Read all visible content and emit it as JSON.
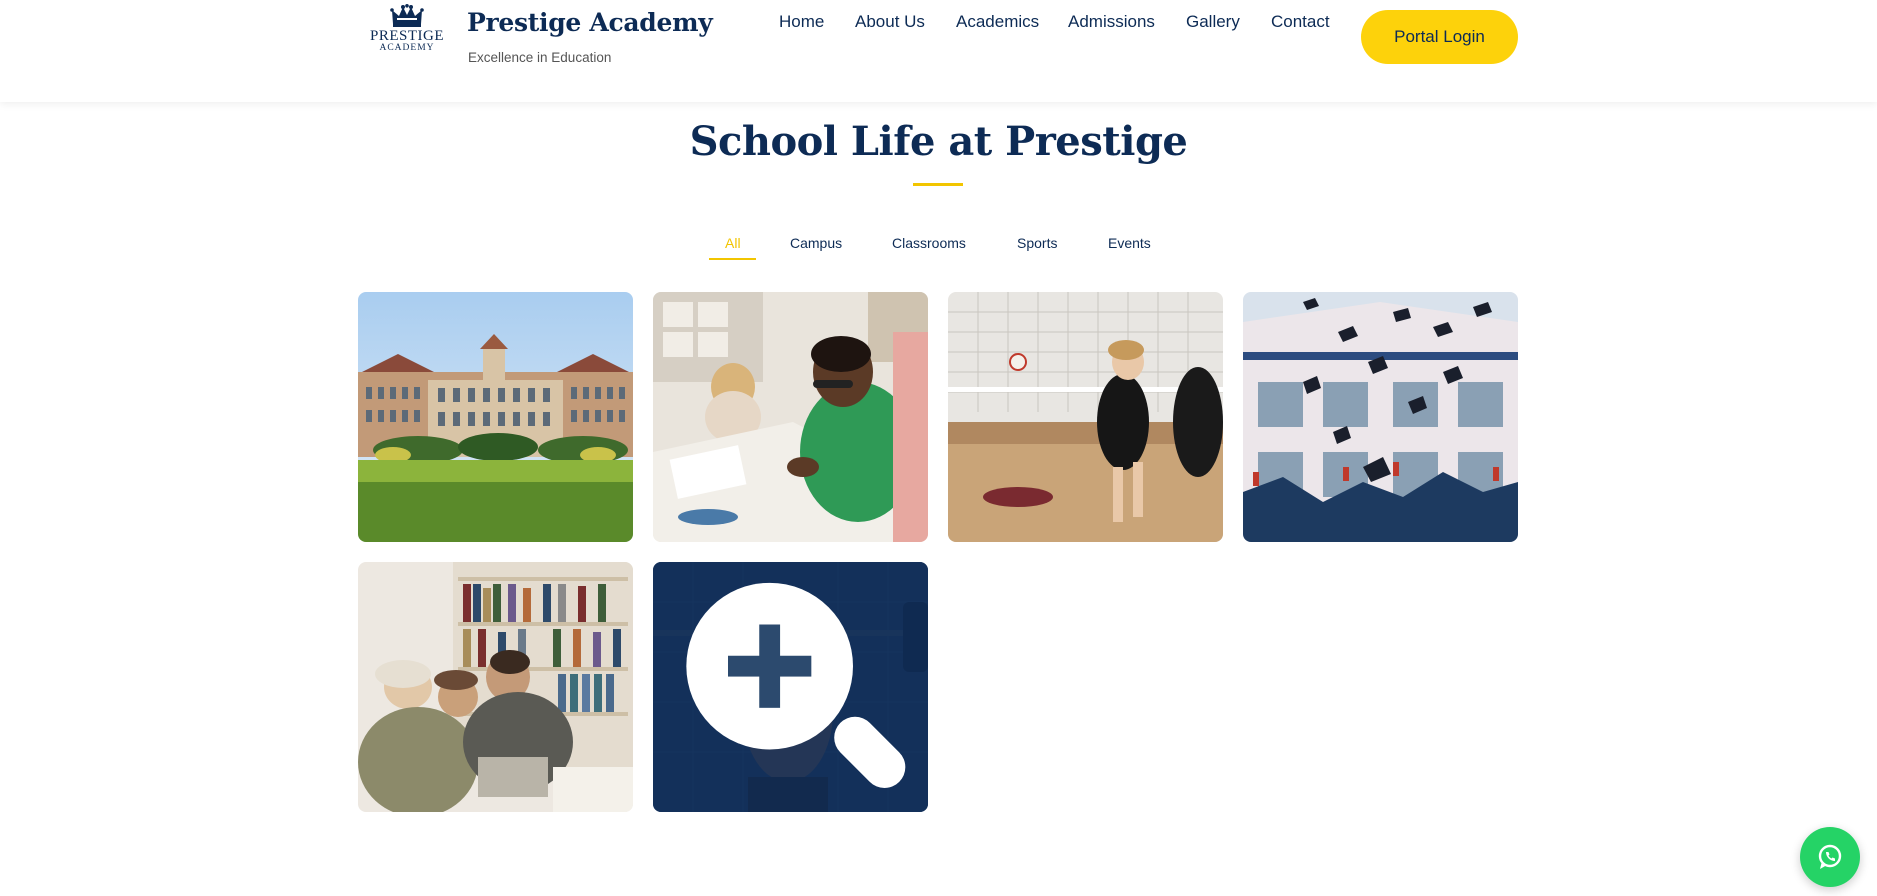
{
  "brand": {
    "logo_line1": "PRESTIGE",
    "logo_line2": "ACADEMY",
    "name": "Prestige Academy",
    "tagline": "Excellence in Education"
  },
  "nav": {
    "items": [
      {
        "label": "Home"
      },
      {
        "label": "About Us"
      },
      {
        "label": "Academics"
      },
      {
        "label": "Admissions"
      },
      {
        "label": "Gallery"
      },
      {
        "label": "Contact"
      }
    ],
    "portal_label": "Portal Login"
  },
  "gallery": {
    "title": "School Life at Prestige",
    "filters": [
      {
        "label": "All",
        "active": true
      },
      {
        "label": "Campus"
      },
      {
        "label": "Classrooms"
      },
      {
        "label": "Sports"
      },
      {
        "label": "Events"
      }
    ],
    "tiles": [
      {
        "category": "campus",
        "icon": "campus-building-photo"
      },
      {
        "category": "classrooms",
        "icon": "students-drawing-photo"
      },
      {
        "category": "sports",
        "icon": "volleyball-photo"
      },
      {
        "category": "events",
        "icon": "graduation-caps-photo"
      },
      {
        "category": "classrooms",
        "icon": "library-group-photo"
      },
      {
        "category": "sports",
        "icon": "weightlifting-photo",
        "hovered": true
      }
    ]
  },
  "colors": {
    "navy": "#0d2b55",
    "accent_yellow": "#fdd20b",
    "whatsapp_green": "#25d366"
  },
  "icons": {
    "zoom": "zoom-in-icon",
    "chat": "whatsapp-icon"
  }
}
